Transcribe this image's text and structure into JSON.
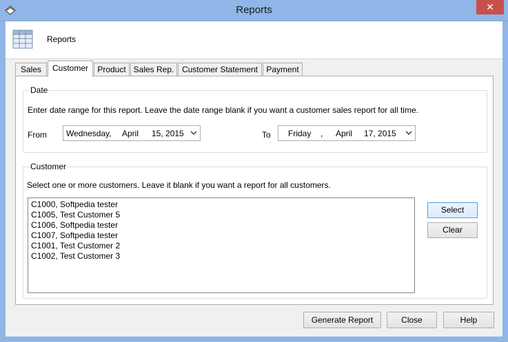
{
  "window": {
    "title": "Reports",
    "close_glyph": "✕"
  },
  "header": {
    "title": "Reports",
    "icon": "table-grid-icon"
  },
  "tabs": [
    {
      "label": "Sales"
    },
    {
      "label": "Customer",
      "active": true
    },
    {
      "label": "Product"
    },
    {
      "label": "Sales Rep."
    },
    {
      "label": "Customer Statement"
    },
    {
      "label": "Payment"
    }
  ],
  "date": {
    "legend": "Date",
    "description": "Enter date range for this report. Leave the date range blank if you want a customer sales report for all time.",
    "from_label": "From",
    "to_label": "To",
    "from": {
      "weekday": "Wednesday,",
      "month": "April",
      "day_year": "15, 2015"
    },
    "to": {
      "weekday": "Friday",
      "sep": ",",
      "month": "April",
      "day_year": "17, 2015"
    }
  },
  "customer": {
    "legend": "Customer",
    "description": "Select one or more customers. Leave it blank if you want a report for all customers.",
    "items": [
      "C1000, Softpedia tester",
      "C1005, Test Customer 5",
      "C1006, Softpedia tester",
      "C1007, Softpedia tester",
      "C1001, Test Customer 2",
      "C1002, Test Customer 3"
    ],
    "select_label": "Select",
    "clear_label": "Clear"
  },
  "buttons": {
    "generate": "Generate Report",
    "close": "Close",
    "help": "Help"
  },
  "colors": {
    "title_bar": "#8fb6e6",
    "close_button": "#c7504b",
    "focus_border": "#569de5"
  }
}
